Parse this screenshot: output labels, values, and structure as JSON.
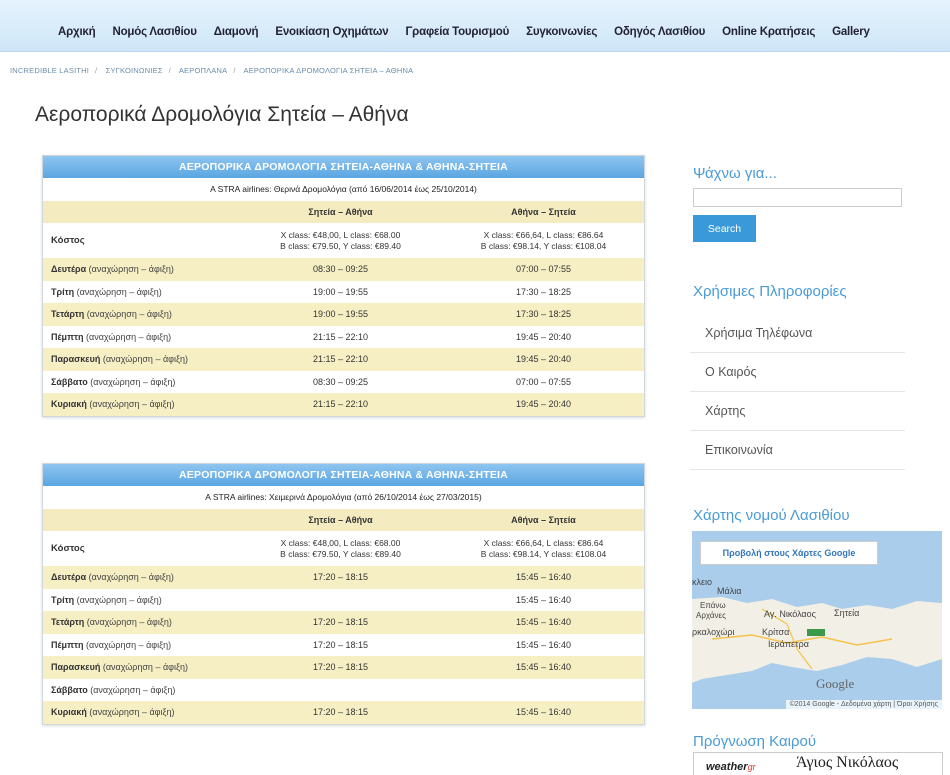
{
  "nav": [
    "Αρχική",
    "Νομός Λασιθίου",
    "Διαμονή",
    "Ενοικίαση Οχημάτων",
    "Γραφεία Τουρισμού",
    "Συγκοινωνίες",
    "Οδηγός Λασιθίου",
    "Online Κρατήσεις",
    "Gallery"
  ],
  "breadcrumb": [
    "INCREDIBLE LASITHI",
    "ΣΥΓΚΟΙΝΩΝΙΕΣ",
    "ΑΕΡΟΠΛΑΝΑ",
    "ΑΕΡΟΠΟΡΙΚΑ ΔΡΟΜΟΛΟΓΙΑ ΣΗΤΕΙΑ – ΑΘΗΝΑ"
  ],
  "page_title": "Αεροπορικά Δρομολόγια Σητεία – Αθήνα",
  "tables": [
    {
      "title": "ΑΕΡΟΠΟΡΙΚΑ ΔΡΟΜΟΛΟΓΙΑ ΣΗΤΕΙΑ-ΑΘΗΝΑ & ΑΘΗΝΑ-ΣΗΤΕΙΑ",
      "subtitle": "A STRA airlines: Θερινά Δρομολόγια (από 16/06/2014 έως 25/10/2014)",
      "col1": "Σητεία – Αθήνα",
      "col2": "Αθήνα – Σητεία",
      "cost_label": "Κόστος",
      "cost1a": "X class: €48,00, L class: €68.00",
      "cost1b": "B class: €79.50, Y class: €89.40",
      "cost2a": "X class: €66,64, L class: €86.64",
      "cost2b": "B class: €98.14, Y class: €108.04",
      "rows": [
        {
          "day": "Δευτέρα",
          "note": "(αναχώρηση – άφιξη)",
          "a": "08:30 – 09:25",
          "b": "07:00 – 07:55"
        },
        {
          "day": "Τρίτη",
          "note": "(αναχώρηση – άφιξη)",
          "a": "19:00 – 19:55",
          "b": "17:30 – 18:25"
        },
        {
          "day": "Τετάρτη",
          "note": "(αναχώρηση – άφιξη)",
          "a": "19:00 – 19:55",
          "b": "17:30 – 18:25"
        },
        {
          "day": "Πέμπτη",
          "note": "(αναχώρηση – άφιξη)",
          "a": "21:15 – 22:10",
          "b": "19:45 – 20:40"
        },
        {
          "day": "Παρασκευή",
          "note": "(αναχώρηση – άφιξη)",
          "a": "21:15 – 22:10",
          "b": "19:45 – 20:40"
        },
        {
          "day": "Σάββατο",
          "note": "(αναχώρηση – άφιξη)",
          "a": "08:30 – 09:25",
          "b": "07:00 – 07:55"
        },
        {
          "day": "Κυριακή",
          "note": "(αναχώρηση – άφιξη)",
          "a": "21:15 – 22:10",
          "b": "19:45 – 20:40"
        }
      ]
    },
    {
      "title": "ΑΕΡΟΠΟΡΙΚΑ ΔΡΟΜΟΛΟΓΙΑ ΣΗΤΕΙΑ-ΑΘΗΝΑ & ΑΘΗΝΑ-ΣΗΤΕΙΑ",
      "subtitle": "A STRA airlines: Χειμερινά Δρομολόγια (από 26/10/2014 έως 27/03/2015)",
      "col1": "Σητεία – Αθήνα",
      "col2": "Αθήνα – Σητεία",
      "cost_label": "Κόστος",
      "cost1a": "X class: €48,00, L class: €68.00",
      "cost1b": "B class: €79.50, Y class: €89.40",
      "cost2a": "X class: €66,64, L class: €86.64",
      "cost2b": "B class: €98.14, Y class: €108.04",
      "rows": [
        {
          "day": "Δευτέρα",
          "note": "(αναχώρηση – άφιξη)",
          "a": "17:20 – 18:15",
          "b": "15:45 – 16:40"
        },
        {
          "day": "Τρίτη",
          "note": "(αναχώρηση – άφιξη)",
          "a": "",
          "b": "15:45 – 16:40"
        },
        {
          "day": "Τετάρτη",
          "note": "(αναχώρηση – άφιξη)",
          "a": "17:20 – 18:15",
          "b": "15:45 – 16:40"
        },
        {
          "day": "Πέμπτη",
          "note": "(αναχώρηση – άφιξη)",
          "a": "17:20 – 18:15",
          "b": "15:45 – 16:40"
        },
        {
          "day": "Παρασκευή",
          "note": "(αναχώρηση – άφιξη)",
          "a": "17:20 – 18:15",
          "b": "15:45 – 16:40"
        },
        {
          "day": "Σάββατο",
          "note": "(αναχώρηση – άφιξη)",
          "a": "",
          "b": ""
        },
        {
          "day": "Κυριακή",
          "note": "(αναχώρηση – άφιξη)",
          "a": "17:20 – 18:15",
          "b": "15:45 – 16:40"
        }
      ]
    }
  ],
  "sidebar": {
    "search_heading": "Ψάχνω για...",
    "search_value": "",
    "search_button": "Search",
    "info_heading": "Χρήσιμες Πληροφορίες",
    "info_items": [
      "Χρήσιμα Τηλέφωνα",
      "Ο Καιρός",
      "Χάρτης",
      "Επικοινωνία"
    ],
    "map_heading": "Χάρτης νομού Λασιθίου",
    "map_button": "Προβολή στους Χάρτες Google",
    "map_labels": [
      "κλειο",
      "Μάλια",
      "Επάνω",
      "Αρχάνες",
      "Αγ. Νικόλαος",
      "Σητεία",
      "ρκαλοχώρι",
      "Κρίτσα",
      "Ιεράπετρα"
    ],
    "map_logo": "Google",
    "map_copyright": "©2014 Google - Δεδομένα χάρτη | Όροι Χρήσης",
    "weather_heading": "Πρόγνωση Καιρού",
    "weather_brand": "weather",
    "weather_brand_suffix": "gr",
    "weather_city": "Άγιος Νικόλαος"
  },
  "colors": {
    "accent": "#4a9bd6",
    "button": "#3a9ad9",
    "table_header": "#5aa6e2",
    "row_highlight": "#f6efc4",
    "nav_bg": "#cfe6f8"
  }
}
